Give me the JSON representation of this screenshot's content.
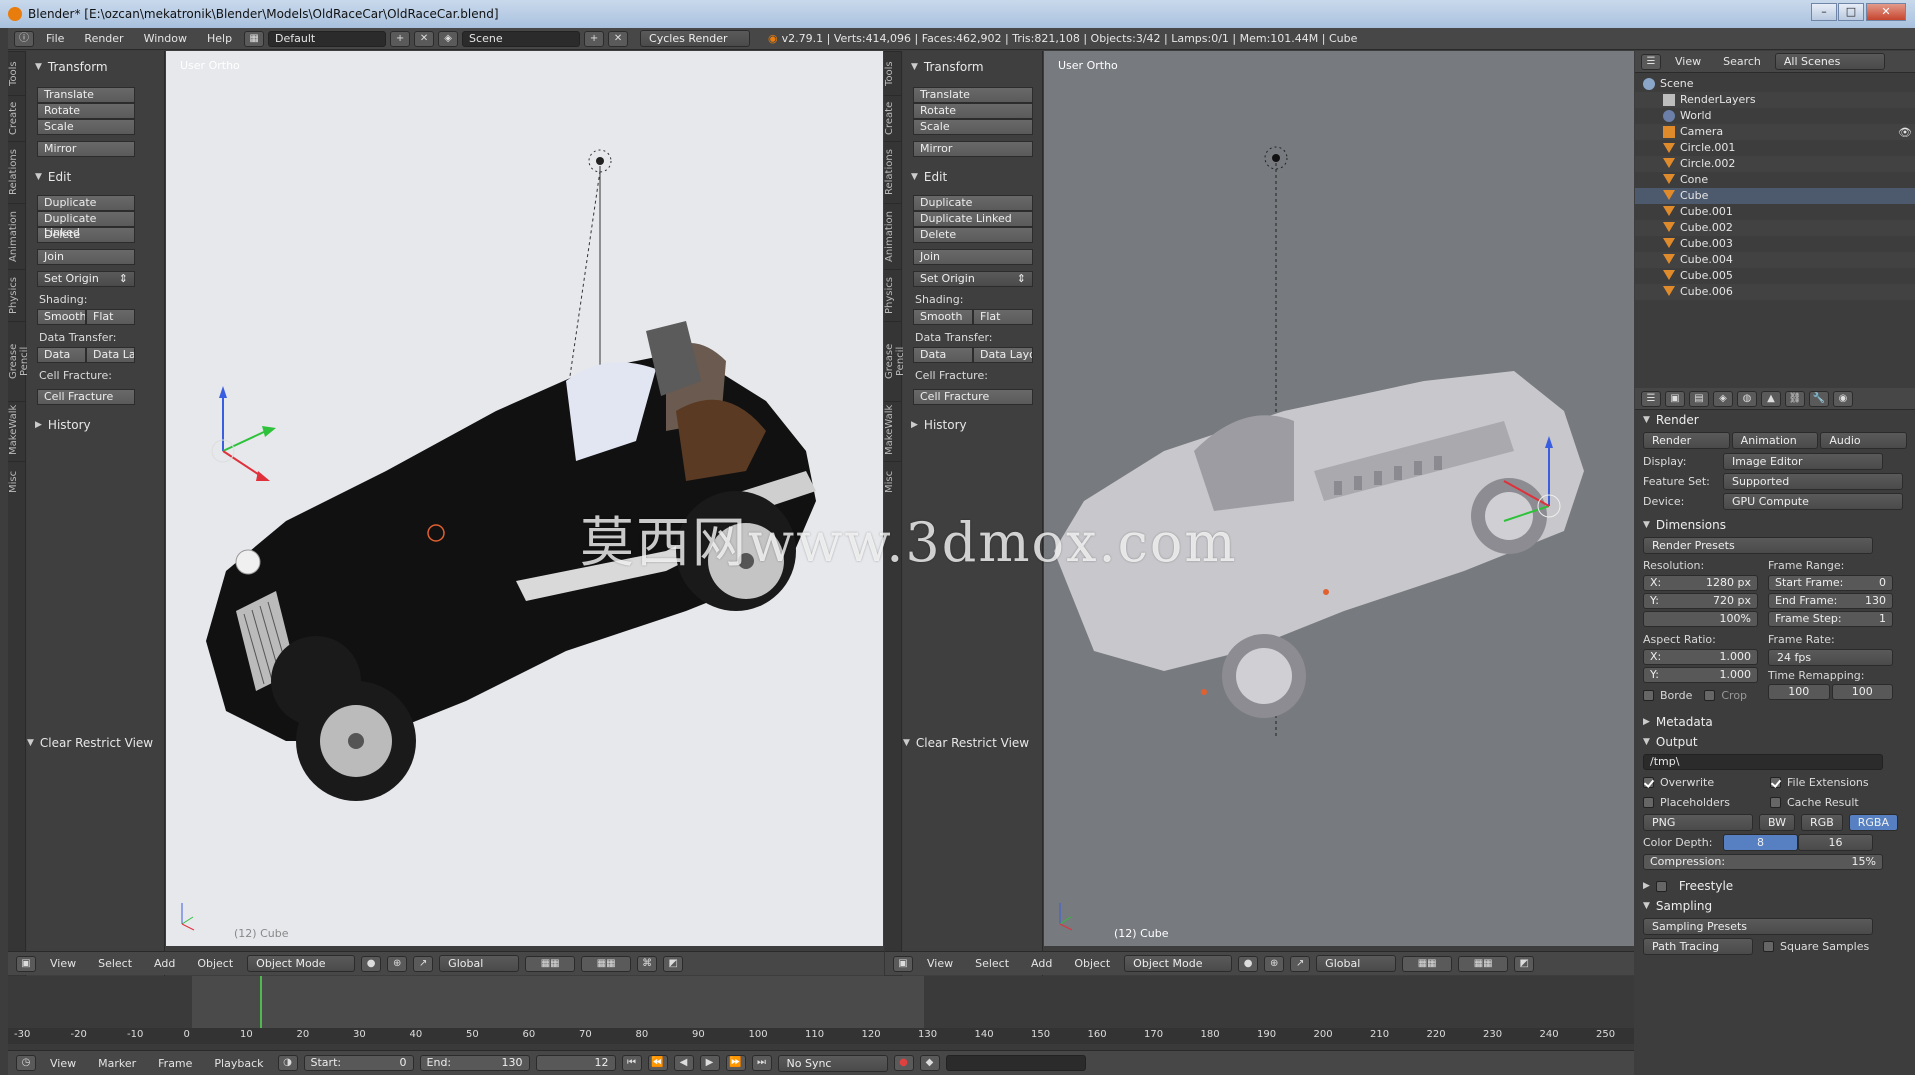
{
  "window": {
    "title": "Blender* [E:\\ozcan\\mekatronik\\Blender\\Models\\OldRaceCar\\OldRaceCar.blend]",
    "minimize": "–",
    "maximize": "□",
    "close": "✕"
  },
  "info": {
    "menus": [
      "File",
      "Render",
      "Window",
      "Help"
    ],
    "layout": "Default",
    "scene": "Scene",
    "engine": "Cycles Render",
    "stats": "v2.79.1 | Verts:414,096 | Faces:462,902 | Tris:821,108 | Objects:3/42 | Lamps:0/1 | Mem:101.44M | Cube"
  },
  "toolshelf": {
    "tabs": [
      "Tools",
      "Create",
      "Relations",
      "Animation",
      "Physics",
      "Grease Pencil",
      "MakeWalk",
      "Misc"
    ],
    "transform_header": "Transform",
    "transform_buttons": [
      "Translate",
      "Rotate",
      "Scale",
      "Mirror"
    ],
    "edit_header": "Edit",
    "edit_buttons": [
      "Duplicate",
      "Duplicate Linked",
      "Delete",
      "Join"
    ],
    "set_origin": "Set Origin",
    "shading_label": "Shading:",
    "smooth": "Smooth",
    "flat": "Flat",
    "data_transfer_label": "Data Transfer:",
    "data": "Data",
    "data_layout": "Data Layo",
    "cell_fracture_label": "Cell Fracture:",
    "cell_fracture_btn": "Cell Fracture",
    "history_header": "History",
    "clear_restrict": "Clear Restrict View"
  },
  "viewport_left": {
    "label": "User Ortho",
    "object": "(12) Cube"
  },
  "viewport_right": {
    "label": "User Ortho",
    "object": "(12) Cube"
  },
  "watermark": "莫西网www.3dmox.com",
  "view3d_header": {
    "menus": [
      "View",
      "Select",
      "Add",
      "Object"
    ],
    "mode": "Object Mode",
    "orientation": "Global"
  },
  "outliner": {
    "menus": [
      "View",
      "Search"
    ],
    "scenes": "All Scenes",
    "rows": [
      "Scene",
      "RenderLayers",
      "World",
      "Camera",
      "Circle.001",
      "Circle.002",
      "Cone",
      "Cube",
      "Cube.001",
      "Cube.002",
      "Cube.003",
      "Cube.004",
      "Cube.005",
      "Cube.006"
    ]
  },
  "properties": {
    "render_header": "Render",
    "render_btn": "Render",
    "animation_btn": "Animation",
    "audio_btn": "Audio",
    "display_label": "Display:",
    "display_value": "Image Editor",
    "feature_label": "Feature Set:",
    "feature_value": "Supported",
    "device_label": "Device:",
    "device_value": "GPU Compute",
    "dimensions_header": "Dimensions",
    "render_presets": "Render Presets",
    "resolution_label": "Resolution:",
    "res_x": "1280 px",
    "res_y": "720 px",
    "res_pct": "100%",
    "frame_range_label": "Frame Range:",
    "start_frame": "0",
    "end_frame": "130",
    "frame_step": "1",
    "start_frame_label": "Start Frame:",
    "end_frame_label": "End Frame:",
    "frame_step_label": "Frame Step:",
    "aspect_label": "Aspect Ratio:",
    "aspect_x": "1.000",
    "aspect_y": "1.000",
    "frame_rate_label": "Frame Rate:",
    "fps": "24 fps",
    "time_remap_label": "Time Remapping:",
    "remap_old": "100",
    "remap_new": "100",
    "border": "Borde",
    "crop": "Crop",
    "metadata_header": "Metadata",
    "output_header": "Output",
    "output_path": "/tmp\\",
    "overwrite": "Overwrite",
    "file_ext": "File Extensions",
    "placeholders": "Placeholders",
    "cache_result": "Cache Result",
    "format": "PNG",
    "bw": "BW",
    "rgb": "RGB",
    "rgba": "RGBA",
    "color_depth_label": "Color Depth:",
    "depth_8": "8",
    "depth_16": "16",
    "compression_label": "Compression:",
    "compression_value": "15%",
    "freestyle_header": "Freestyle",
    "sampling_header": "Sampling",
    "sampling_presets": "Sampling Presets",
    "path_tracing": "Path Tracing",
    "square_samples": "Square Samples",
    "x_label": "X:",
    "y_label": "Y:"
  },
  "timeline": {
    "ticks": [
      "-30",
      "-20",
      "-10",
      "0",
      "10",
      "20",
      "30",
      "40",
      "50",
      "60",
      "70",
      "80",
      "90",
      "100",
      "110",
      "120",
      "130",
      "140",
      "150",
      "160",
      "170",
      "180",
      "190",
      "200",
      "210",
      "220",
      "230",
      "240",
      "250"
    ],
    "menus": [
      "View",
      "Marker",
      "Frame",
      "Playback"
    ],
    "start_label": "Start:",
    "start": "0",
    "end_label": "End:",
    "end": "130",
    "current": "12",
    "sync": "No Sync"
  },
  "colors": {
    "accent_blue": "#5680c2",
    "orange": "#e87d0d",
    "active_frame": "#4fb84f"
  }
}
